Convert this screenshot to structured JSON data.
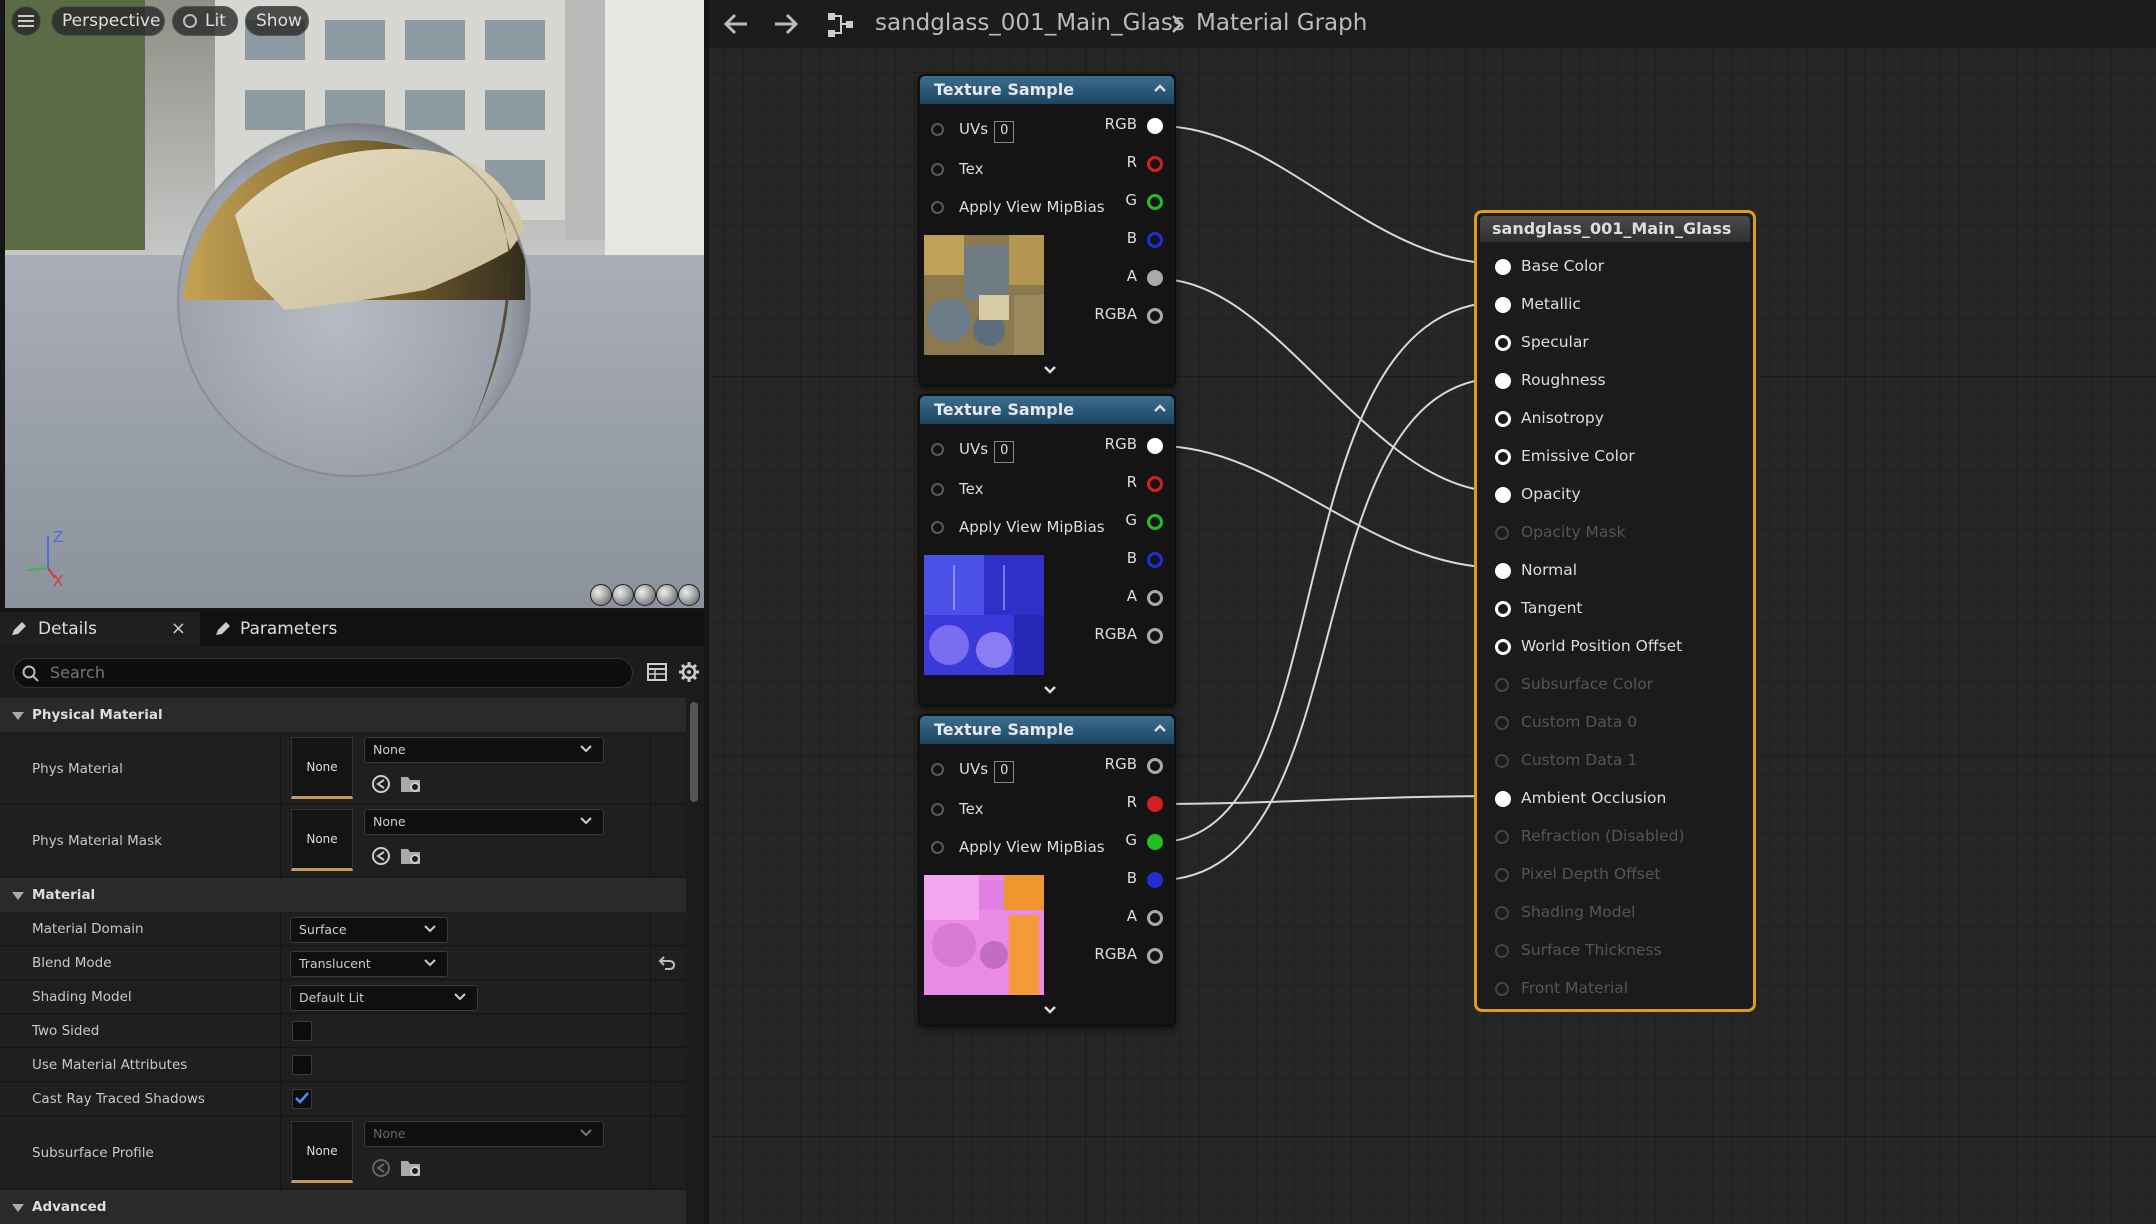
{
  "viewport": {
    "menu_icon": "hamburger-icon",
    "perspective_label": "Perspective",
    "lit_label": "Lit",
    "show_label": "Show",
    "axis_z": "Z",
    "axis_x": "X"
  },
  "details": {
    "tab_details": "Details",
    "tab_close": "×",
    "tab_parameters": "Parameters",
    "search_placeholder": "Search",
    "sections": {
      "physical": "Physical Material",
      "material": "Material",
      "advanced": "Advanced"
    },
    "rows": {
      "phys_material": {
        "label": "Phys Material",
        "thumb": "None",
        "value": "None"
      },
      "phys_material_mask": {
        "label": "Phys Material Mask",
        "thumb": "None",
        "value": "None"
      },
      "material_domain": {
        "label": "Material Domain",
        "value": "Surface"
      },
      "blend_mode": {
        "label": "Blend Mode",
        "value": "Translucent"
      },
      "shading_model": {
        "label": "Shading Model",
        "value": "Default Lit"
      },
      "two_sided": {
        "label": "Two Sided",
        "checked": false
      },
      "use_material_attributes": {
        "label": "Use Material Attributes",
        "checked": false
      },
      "cast_ray_traced_shadows": {
        "label": "Cast Ray Traced Shadows",
        "checked": true
      },
      "subsurface_profile": {
        "label": "Subsurface Profile",
        "thumb": "None",
        "value": "None"
      }
    }
  },
  "graph": {
    "asset_name": "sandglass_001_Main_Glass",
    "page_name": "Material Graph",
    "texture_nodes": [
      {
        "title": "Texture Sample",
        "uvs_label": "UVs",
        "uvs_value": "0",
        "tex_label": "Tex",
        "mip_label": "Apply View MipBias",
        "outputs": [
          "RGB",
          "R",
          "G",
          "B",
          "A",
          "RGBA"
        ]
      },
      {
        "title": "Texture Sample",
        "uvs_label": "UVs",
        "uvs_value": "0",
        "tex_label": "Tex",
        "mip_label": "Apply View MipBias",
        "outputs": [
          "RGB",
          "R",
          "G",
          "B",
          "A",
          "RGBA"
        ]
      },
      {
        "title": "Texture Sample",
        "uvs_label": "UVs",
        "uvs_value": "0",
        "tex_label": "Tex",
        "mip_label": "Apply View MipBias",
        "outputs": [
          "RGB",
          "R",
          "G",
          "B",
          "A",
          "RGBA"
        ]
      }
    ],
    "main_node": {
      "title": "sandglass_001_Main_Glass",
      "pins": [
        "Base Color",
        "Metallic",
        "Specular",
        "Roughness",
        "Anisotropy",
        "Emissive Color",
        "Opacity",
        "Opacity Mask",
        "Normal",
        "Tangent",
        "World Position Offset",
        "Subsurface Color",
        "Custom Data 0",
        "Custom Data 1",
        "Ambient Occlusion",
        "Refraction (Disabled)",
        "Pixel Depth Offset",
        "Shading Model",
        "Surface Thickness",
        "Front Material"
      ]
    }
  },
  "colors": {
    "node_header": "#2b5a7c",
    "selection": "#e09a20",
    "red_pin": "#d42020",
    "green_pin": "#20c020",
    "blue_pin": "#2030d0"
  }
}
